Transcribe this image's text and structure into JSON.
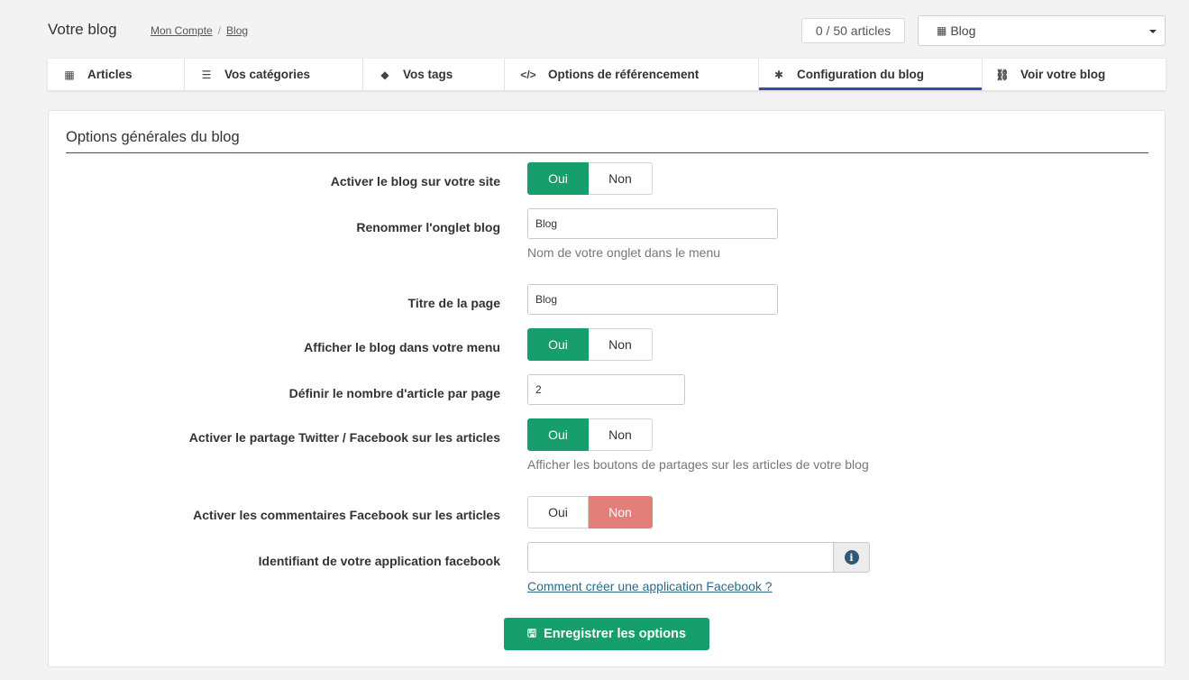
{
  "header": {
    "title": "Votre blog",
    "breadcrumb": [
      "Mon Compte",
      "Blog"
    ],
    "breadcrumb_sep": "/",
    "article_count": "0 / 50 articles",
    "blog_select": {
      "icon": "newspaper-icon",
      "value": "Blog"
    }
  },
  "tabs": [
    {
      "label": "Articles",
      "icon": "newspaper-icon",
      "glyph": "▦",
      "active": false
    },
    {
      "label": "Vos catégories",
      "icon": "list-icon",
      "glyph": "☰",
      "active": false
    },
    {
      "label": "Vos tags",
      "icon": "tags-icon",
      "glyph": "◆",
      "active": false
    },
    {
      "label": "Options de référencement",
      "icon": "code-icon",
      "glyph": "</>",
      "active": false
    },
    {
      "label": "Configuration du blog",
      "icon": "gear-icon",
      "glyph": "✱",
      "active": true
    },
    {
      "label": "Voir votre blog",
      "icon": "link-icon",
      "glyph": "⛓",
      "active": false
    }
  ],
  "panel": {
    "title": "Options générales du blog",
    "fields": {
      "enable_blog": {
        "label": "Activer le blog sur votre site",
        "yes": "Oui",
        "no": "Non",
        "value": "Oui"
      },
      "rename_tab": {
        "label": "Renommer l'onglet blog",
        "value": "Blog",
        "help": "Nom de votre onglet dans le menu"
      },
      "page_title": {
        "label": "Titre de la page",
        "value": "Blog"
      },
      "show_in_menu": {
        "label": "Afficher le blog dans votre menu",
        "yes": "Oui",
        "no": "Non",
        "value": "Oui"
      },
      "articles_per_page": {
        "label": "Définir le nombre d'article par page",
        "value": "2"
      },
      "social_share": {
        "label": "Activer le partage Twitter / Facebook sur les articles",
        "yes": "Oui",
        "no": "Non",
        "value": "Oui",
        "help": "Afficher les boutons de partages sur les articles de votre blog"
      },
      "fb_comments": {
        "label": "Activer les commentaires Facebook sur les articles",
        "yes": "Oui",
        "no": "Non",
        "value": "Non"
      },
      "fb_app_id": {
        "label": "Identifiant de votre application facebook",
        "value": "",
        "info_icon": "info-circle-icon",
        "link": "Comment créer une application Facebook ?"
      }
    },
    "save_button": {
      "label": "Enregistrer les options",
      "icon": "save-icon"
    }
  },
  "colors": {
    "toggle_on": "#169e6d",
    "toggle_off_red": "#e27f7a",
    "active_tab": "#2f4fa8",
    "link": "#2c6a86"
  }
}
